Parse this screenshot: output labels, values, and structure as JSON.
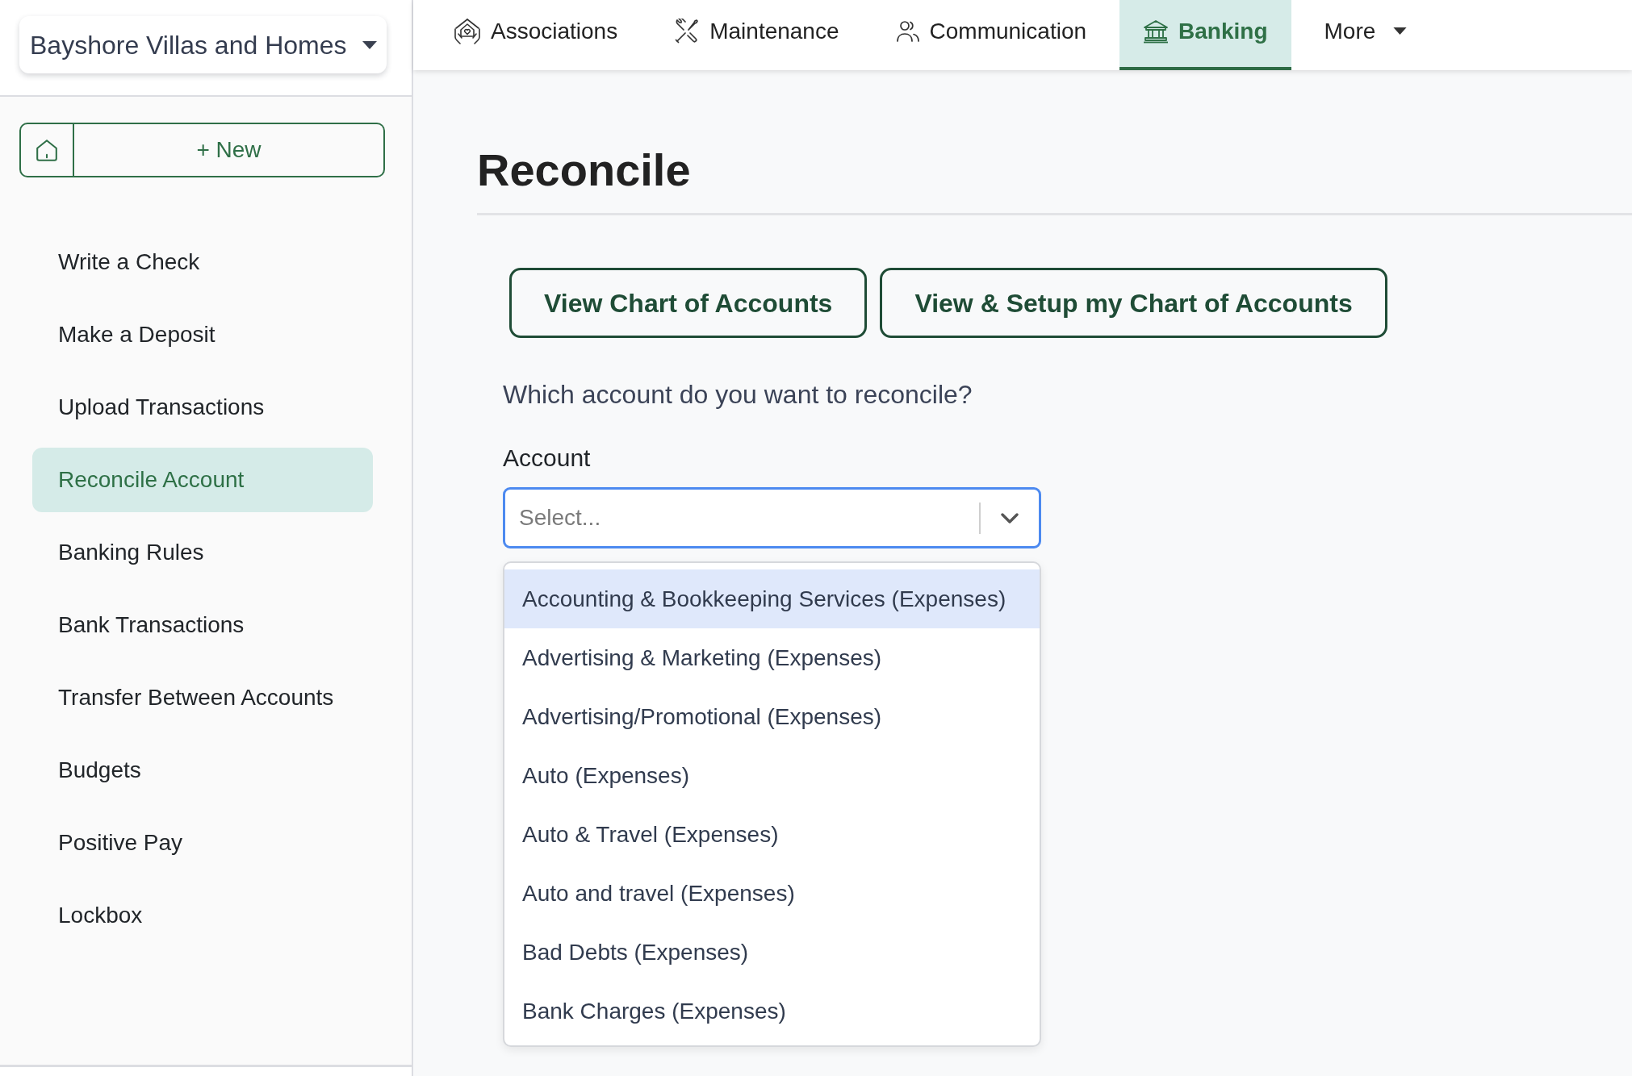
{
  "property_switcher": {
    "label": "Bayshore Villas and Homes"
  },
  "sidebar": {
    "new_button": {
      "label": "+ New"
    },
    "items": [
      {
        "label": "Write a Check",
        "selected": false
      },
      {
        "label": "Make a Deposit",
        "selected": false
      },
      {
        "label": "Upload Transactions",
        "selected": false
      },
      {
        "label": "Reconcile Account",
        "selected": true
      },
      {
        "label": "Banking Rules",
        "selected": false
      },
      {
        "label": "Bank Transactions",
        "selected": false
      },
      {
        "label": "Transfer Between Accounts",
        "selected": false
      },
      {
        "label": "Budgets",
        "selected": false
      },
      {
        "label": "Positive Pay",
        "selected": false
      },
      {
        "label": "Lockbox",
        "selected": false
      }
    ]
  },
  "top_nav": {
    "tabs": [
      {
        "label": "Associations",
        "kind": "link",
        "selected": false
      },
      {
        "label": "Maintenance",
        "kind": "link",
        "selected": false
      },
      {
        "label": "Communication",
        "kind": "link",
        "selected": false
      },
      {
        "label": "Banking",
        "kind": "link",
        "selected": true
      },
      {
        "label": "More",
        "kind": "dropdown",
        "selected": false
      }
    ]
  },
  "page": {
    "title": "Reconcile",
    "buttons": [
      "View Chart of Accounts",
      "View & Setup my Chart of Accounts"
    ],
    "question": "Which account do you want to reconcile?",
    "account_field": {
      "label": "Account",
      "placeholder": "Select...",
      "focused": true,
      "expanded": true,
      "options": [
        {
          "label": "Accounting & Bookkeeping Services (Expenses)",
          "selected": true
        },
        {
          "label": "Advertising & Marketing (Expenses)",
          "selected": false
        },
        {
          "label": "Advertising/Promotional (Expenses)",
          "selected": false
        },
        {
          "label": "Auto (Expenses)",
          "selected": false
        },
        {
          "label": "Auto & Travel (Expenses)",
          "selected": false
        },
        {
          "label": "Auto and travel (Expenses)",
          "selected": false
        },
        {
          "label": "Bad Debts (Expenses)",
          "selected": false
        },
        {
          "label": "Bank Charges (Expenses)",
          "selected": false
        }
      ]
    }
  }
}
